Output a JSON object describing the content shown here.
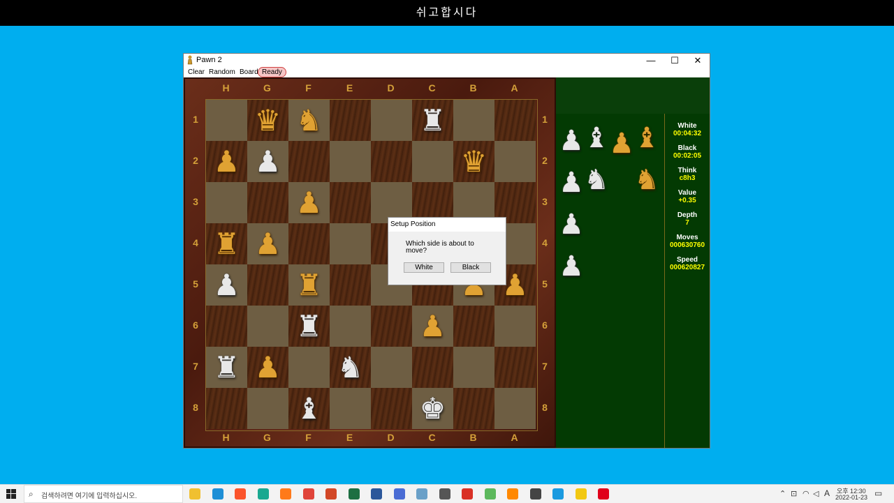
{
  "topbar": {
    "title": "쉬고합시다"
  },
  "window": {
    "title": "Pawn 2",
    "controls": {
      "minimize": "—",
      "maximize": "☐",
      "close": "✕"
    }
  },
  "menu": {
    "items": [
      "Clear",
      "Random",
      "Board",
      "Ready"
    ]
  },
  "board": {
    "files": [
      "H",
      "G",
      "F",
      "E",
      "D",
      "C",
      "B",
      "A"
    ],
    "ranks": [
      "1",
      "2",
      "3",
      "4",
      "5",
      "6",
      "7",
      "8"
    ],
    "pieces": [
      {
        "r": 0,
        "c": 1,
        "g": "♛",
        "color": "gold",
        "name": "gold-queen-icon"
      },
      {
        "r": 0,
        "c": 2,
        "g": "♞",
        "color": "gold",
        "name": "gold-knight-icon"
      },
      {
        "r": 0,
        "c": 5,
        "g": "♜",
        "color": "silver",
        "name": "silver-rook-icon"
      },
      {
        "r": 1,
        "c": 0,
        "g": "♟",
        "color": "gold",
        "name": "gold-pawn-icon"
      },
      {
        "r": 1,
        "c": 1,
        "g": "♟",
        "color": "silver",
        "name": "silver-pawn-icon"
      },
      {
        "r": 1,
        "c": 6,
        "g": "♛",
        "color": "gold",
        "name": "gold-queen-icon"
      },
      {
        "r": 2,
        "c": 2,
        "g": "♟",
        "color": "gold",
        "name": "gold-pawn-icon"
      },
      {
        "r": 3,
        "c": 0,
        "g": "♜",
        "color": "gold",
        "name": "gold-rook-icon"
      },
      {
        "r": 3,
        "c": 1,
        "g": "♟",
        "color": "gold",
        "name": "gold-pawn-icon"
      },
      {
        "r": 4,
        "c": 0,
        "g": "♟",
        "color": "silver",
        "name": "silver-pawn-icon"
      },
      {
        "r": 4,
        "c": 2,
        "g": "♜",
        "color": "gold",
        "name": "gold-rook-icon"
      },
      {
        "r": 4,
        "c": 6,
        "g": "♟",
        "color": "gold",
        "name": "gold-pawn-icon"
      },
      {
        "r": 4,
        "c": 7,
        "g": "♟",
        "color": "gold",
        "name": "gold-pawn-icon"
      },
      {
        "r": 5,
        "c": 2,
        "g": "♜",
        "color": "silver",
        "name": "silver-rook-icon"
      },
      {
        "r": 5,
        "c": 5,
        "g": "♟",
        "color": "gold",
        "name": "gold-pawn-icon"
      },
      {
        "r": 6,
        "c": 0,
        "g": "♜",
        "color": "silver",
        "name": "silver-rook-icon"
      },
      {
        "r": 6,
        "c": 1,
        "g": "♟",
        "color": "gold",
        "name": "gold-pawn-icon"
      },
      {
        "r": 6,
        "c": 3,
        "g": "♞",
        "color": "silver",
        "name": "silver-knight-icon"
      },
      {
        "r": 7,
        "c": 2,
        "g": "♝",
        "color": "silver",
        "name": "silver-bishop-icon"
      },
      {
        "r": 7,
        "c": 5,
        "g": "♚",
        "color": "silver",
        "name": "silver-king-icon"
      }
    ]
  },
  "captured": [
    {
      "g": "♟",
      "color": "silver",
      "name": "captured-silver-pawn-icon"
    },
    {
      "g": "♝",
      "color": "silver",
      "name": "captured-silver-bishop-icon"
    },
    {
      "g": "♟",
      "color": "gold",
      "name": "captured-gold-pawn-icon"
    },
    {
      "g": "♝",
      "color": "gold",
      "name": "captured-gold-bishop-icon"
    },
    {
      "g": "♟",
      "color": "silver",
      "name": "captured-silver-pawn-icon"
    },
    {
      "g": "♞",
      "color": "silver",
      "name": "captured-silver-knight-icon"
    },
    {
      "g": "♞",
      "color": "gold",
      "name": "captured-gold-knight-icon"
    },
    {
      "g": "♟",
      "color": "silver",
      "name": "captured-silver-pawn-icon"
    },
    {
      "g": "♟",
      "color": "silver",
      "name": "captured-silver-pawn-icon"
    }
  ],
  "stats": [
    {
      "label": "White",
      "value": "00:04:32"
    },
    {
      "label": "Black",
      "value": "00:02:05"
    },
    {
      "label": "Think",
      "value": "c8h3"
    },
    {
      "label": "Value",
      "value": "+0.35"
    },
    {
      "label": "Depth",
      "value": "7"
    },
    {
      "label": "Moves",
      "value": "000630760"
    },
    {
      "label": "Speed",
      "value": "000620827"
    }
  ],
  "dialog": {
    "title": "Setup Position",
    "question": "Which side is about to move?",
    "white_label": "White",
    "black_label": "Black"
  },
  "taskbar": {
    "search_placeholder": "검색하려면 여기에 입력하십시오.",
    "apps": [
      "file-explorer",
      "edge",
      "brave",
      "app-green",
      "firefox",
      "chrome",
      "powerpoint",
      "excel",
      "word",
      "app-blue",
      "app-monitor",
      "search-tool",
      "app-red",
      "app-green2",
      "vlc",
      "calculator",
      "app-circle",
      "sticky-notes",
      "opera"
    ],
    "app_colors": [
      "#f0c030",
      "#1e8fd6",
      "#fb542b",
      "#1aa890",
      "#ff7a1a",
      "#e0443a",
      "#d24726",
      "#1d6f42",
      "#2b579a",
      "#4a6cd4",
      "#6aa0c8",
      "#555555",
      "#d93025",
      "#5cb85c",
      "#ff8800",
      "#444444",
      "#1a9ae0",
      "#f2c811",
      "#e0001a"
    ],
    "ime_mode": "A",
    "clock_ampm": "오후 12:30",
    "clock_date": "2022-01-23"
  }
}
